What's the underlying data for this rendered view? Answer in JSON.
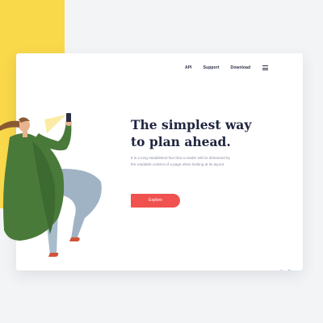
{
  "nav": {
    "items": [
      {
        "label": "API"
      },
      {
        "label": "Support"
      },
      {
        "label": "Download"
      }
    ],
    "menu_icon": "hamburger-menu-icon"
  },
  "hero": {
    "title_line1": "The simplest way",
    "title_line2": "to plan ahead.",
    "body": "It is a long established fact that a reader will be distracted by the readable content of a page when looking at its layout.",
    "cta_label": "Explore"
  },
  "colors": {
    "accent_yellow": "#f9d84a",
    "button_red": "#f0524f",
    "title_navy": "#1f2540",
    "coat_green": "#4a7a3a",
    "pants_blue": "#9fb3c4",
    "leaf_teal": "#6eaab5"
  },
  "illustration": {
    "subject": "woman-holding-phone-illustration",
    "decor": "leaves-illustration"
  }
}
